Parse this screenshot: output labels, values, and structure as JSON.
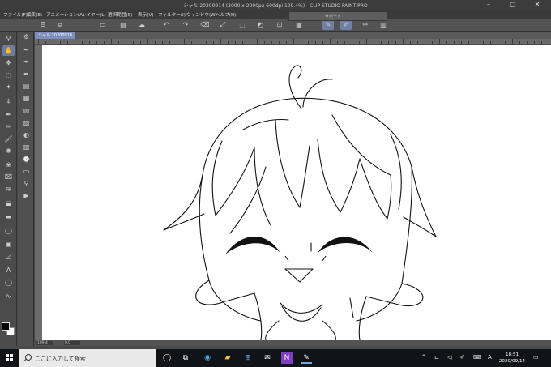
{
  "window": {
    "title": "シャル 20200914 (3000 x 2000px 600dpi 109.4%) - CLIP STUDIO PAINT PRO",
    "min_label": "–",
    "max_label": "□",
    "close_label": "✕"
  },
  "menu": [
    {
      "label": "ファイル(F)"
    },
    {
      "label": "編集(E)"
    },
    {
      "label": "アニメーション(A)"
    },
    {
      "label": "レイヤー(L)"
    },
    {
      "label": "選択範囲(S)"
    },
    {
      "label": "表示(V)"
    },
    {
      "label": "フィルター(I)"
    },
    {
      "label": "ウィンドウ(W)"
    },
    {
      "label": "ヘルプ(H)"
    }
  ],
  "floating_panel": {
    "title": "サポート"
  },
  "toolbar": {
    "buttons": [
      {
        "icon": "menu-icon",
        "glyph": "☰"
      },
      {
        "icon": "new-canvas-icon",
        "glyph": "⧉"
      },
      {
        "icon": "open-icon",
        "glyph": "▭"
      },
      {
        "icon": "save-icon",
        "glyph": "▤"
      },
      {
        "icon": "cloud-icon",
        "glyph": "☁"
      },
      {
        "icon": "undo-icon",
        "glyph": "↶"
      },
      {
        "icon": "redo-icon",
        "glyph": "↷"
      },
      {
        "icon": "clear-icon",
        "glyph": "⌫"
      },
      {
        "icon": "transform-icon",
        "glyph": "⤢"
      },
      {
        "icon": "deselect-icon",
        "glyph": "⬚"
      },
      {
        "icon": "invert-selection-icon",
        "glyph": "◩"
      },
      {
        "icon": "crop-icon",
        "glyph": "⊡"
      },
      {
        "icon": "fill-selection-icon",
        "glyph": "▦"
      },
      {
        "icon": "pen-settings-icon",
        "glyph": "✎"
      },
      {
        "icon": "eraser-settings-icon",
        "glyph": "✐"
      },
      {
        "icon": "brush-icon",
        "glyph": "✏"
      },
      {
        "icon": "ruler-toggle-icon",
        "glyph": "▥"
      }
    ]
  },
  "tools": [
    {
      "icon": "zoom-icon",
      "glyph": "⚲"
    },
    {
      "icon": "hand-icon",
      "glyph": "✋",
      "active": true
    },
    {
      "icon": "move-icon",
      "glyph": "✥"
    },
    {
      "icon": "lasso-icon",
      "glyph": "◌"
    },
    {
      "icon": "magic-wand-icon",
      "glyph": "✦"
    },
    {
      "icon": "eyedropper-icon",
      "glyph": "⍋"
    },
    {
      "icon": "pen-icon",
      "glyph": "✒"
    },
    {
      "icon": "pencil-icon",
      "glyph": "✏"
    },
    {
      "icon": "brush-tool-icon",
      "glyph": "🖌"
    },
    {
      "icon": "airbrush-icon",
      "glyph": "✺"
    },
    {
      "icon": "decoration-icon",
      "glyph": "❀"
    },
    {
      "icon": "eraser-icon",
      "glyph": "⌧"
    },
    {
      "icon": "blend-icon",
      "glyph": "≋"
    },
    {
      "icon": "fill-icon",
      "glyph": "⬓"
    },
    {
      "icon": "gradient-icon",
      "glyph": "▬"
    },
    {
      "icon": "figure-icon",
      "glyph": "◯"
    },
    {
      "icon": "frame-icon",
      "glyph": "▣"
    },
    {
      "icon": "ruler-icon",
      "glyph": "◿"
    },
    {
      "icon": "text-icon",
      "glyph": "A"
    },
    {
      "icon": "balloon-icon",
      "glyph": "◯"
    },
    {
      "icon": "correct-line-icon",
      "glyph": "∿"
    }
  ],
  "subtools": [
    {
      "icon": "subtool-settings-icon",
      "glyph": "⚙"
    },
    {
      "icon": "pen-g-icon",
      "glyph": "✒"
    },
    {
      "icon": "pen-round-icon",
      "glyph": "✒"
    },
    {
      "icon": "pen-maru-icon",
      "glyph": "✒"
    },
    {
      "icon": "layer-panel-icon",
      "glyph": "▤"
    },
    {
      "icon": "layer-list-icon",
      "glyph": "▦"
    },
    {
      "icon": "layer-property-icon",
      "glyph": "▧"
    },
    {
      "icon": "navigator-icon",
      "glyph": "▨"
    },
    {
      "icon": "color-wheel-icon",
      "glyph": "◐"
    },
    {
      "icon": "material-icon",
      "glyph": "▥"
    },
    {
      "icon": "history-icon",
      "glyph": "⌚"
    },
    {
      "icon": "sub-view-icon",
      "glyph": "▭"
    },
    {
      "icon": "layer-search-icon",
      "glyph": "⚲"
    },
    {
      "icon": "animation-icon",
      "glyph": "▶"
    },
    {
      "icon": "3d-icon",
      "glyph": "◈"
    }
  ],
  "canvas": {
    "tab_label": "シャル 20200914",
    "zoom_value": "109.4",
    "rotation_value": "0.0"
  },
  "colors": {
    "main": "#000000",
    "sub": "#ffffff",
    "accent": "#7d8fbe"
  },
  "taskbar": {
    "search_placeholder": "ここに入力して検索",
    "apps": [
      {
        "icon": "task-view-icon",
        "glyph": "◯"
      },
      {
        "icon": "multitask-icon",
        "glyph": "⧉"
      },
      {
        "icon": "edge-icon",
        "glyph": "◉"
      },
      {
        "icon": "explorer-icon",
        "glyph": "▰"
      },
      {
        "icon": "store-icon",
        "glyph": "⊞"
      },
      {
        "icon": "mail-icon",
        "glyph": "✉"
      },
      {
        "icon": "onenote-icon",
        "glyph": "N"
      },
      {
        "icon": "clipstudio-icon",
        "glyph": "✎"
      }
    ],
    "tray": [
      {
        "icon": "tray-up-icon",
        "glyph": "^"
      },
      {
        "icon": "network-icon",
        "glyph": "⊏"
      },
      {
        "icon": "volume-icon",
        "glyph": "◁"
      },
      {
        "icon": "pen-tray-icon",
        "glyph": "✐"
      },
      {
        "icon": "keyboard-icon",
        "glyph": "⌨"
      },
      {
        "icon": "ime-icon",
        "glyph": "A"
      }
    ],
    "time": "18:51",
    "date": "2020/09/14",
    "notifications_glyph": "▭"
  }
}
